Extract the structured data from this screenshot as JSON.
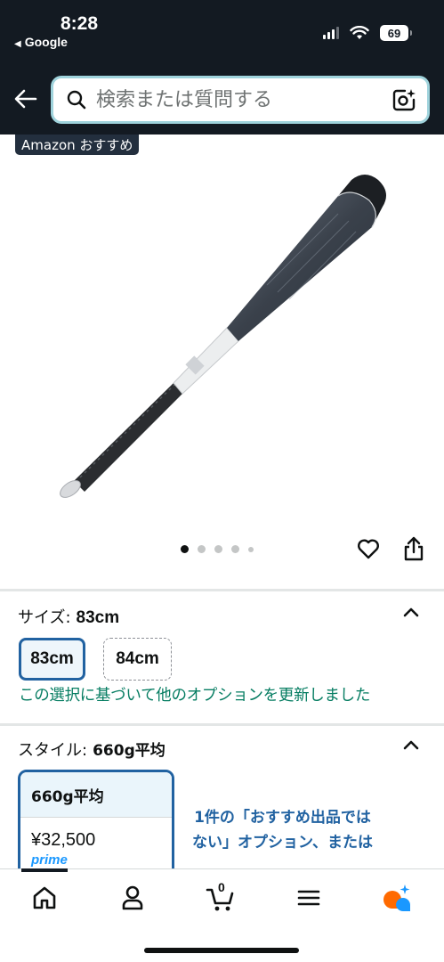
{
  "status_bar": {
    "time": "8:28",
    "back_app": "Google",
    "battery": "69",
    "icons": [
      "signal-icon",
      "wifi-icon",
      "battery-icon"
    ]
  },
  "header": {
    "back_icon": "back-arrow-icon",
    "search_placeholder": "検索または質問する",
    "camera_icon": "camera-icon"
  },
  "product": {
    "badge": "Amazon おすすめ",
    "image_icon": "baseball-bat-image",
    "image_count": 5,
    "active_image": 1
  },
  "size": {
    "label": "サイズ:",
    "selected_value": "83cm",
    "options": [
      "83cm",
      "84cm"
    ],
    "note": "この選択に基づいて他のオプションを更新しました"
  },
  "style": {
    "label": "スタイル:",
    "selected_value": "660g平均",
    "card_title": "660g平均",
    "card_price": "¥32,500",
    "card_prime": "prime",
    "non_recommended": "1件の「おすすめ出品ではない」オプション、または"
  },
  "bottom_nav": {
    "items": [
      "home-icon",
      "account-icon",
      "cart-icon",
      "menu-icon",
      "rufus-icon"
    ],
    "cart_count": "0"
  },
  "colors": {
    "header_bg": "#131a22",
    "selected_border": "#2162a1",
    "success_text": "#067d62",
    "link_blue": "#2162a1"
  }
}
